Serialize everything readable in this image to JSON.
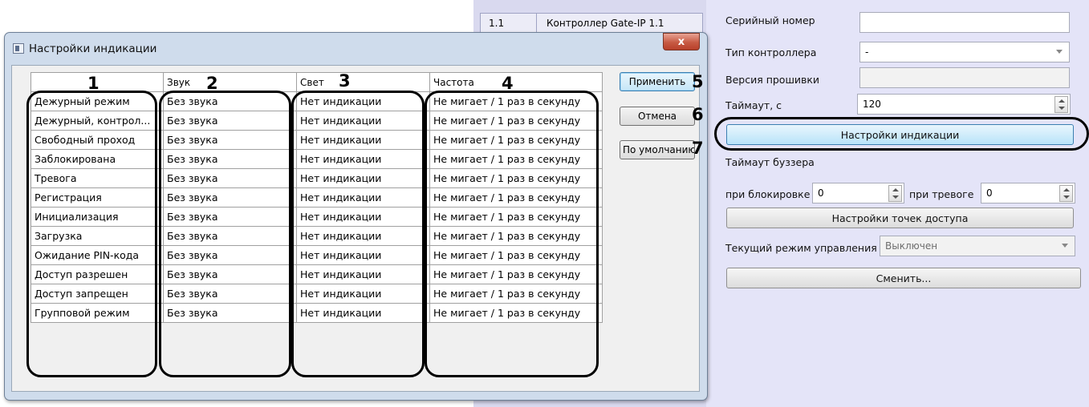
{
  "background": {
    "list_row": {
      "id": "1.1",
      "name": "Контроллер Gate-IP 1.1"
    },
    "serial_label": "Серийный номер",
    "serial_value": "",
    "type_label": "Тип контроллера",
    "type_value": "-",
    "firmware_label": "Версия прошивки",
    "firmware_value": "",
    "timeout_label": "Таймаут, с",
    "timeout_value": "120",
    "indication_button": "Настройки индикации",
    "buzzer_label": "Таймаут буззера",
    "block_label": "при блокировке",
    "block_value": "0",
    "alarm_label": "при тревоге",
    "alarm_value": "0",
    "access_points_button": "Настройки точек доступа",
    "mode_label": "Текущий режим управления",
    "mode_value": "Выключен",
    "change_button": "Сменить..."
  },
  "dialog": {
    "title": "Настройки индикации",
    "close_label": "x",
    "headers": [
      "",
      "Звук",
      "Свет",
      "Частота"
    ],
    "rows": [
      [
        "Дежурный режим",
        "Без звука",
        "Нет индикации",
        "Не мигает / 1 раз в секунду"
      ],
      [
        "Дежурный, контрол...",
        "Без звука",
        "Нет индикации",
        "Не мигает / 1 раз в секунду"
      ],
      [
        "Свободный проход",
        "Без звука",
        "Нет индикации",
        "Не мигает / 1 раз в секунду"
      ],
      [
        "Заблокирована",
        "Без звука",
        "Нет индикации",
        "Не мигает / 1 раз в секунду"
      ],
      [
        "Тревога",
        "Без звука",
        "Нет индикации",
        "Не мигает / 1 раз в секунду"
      ],
      [
        "Регистрация",
        "Без звука",
        "Нет индикации",
        "Не мигает / 1 раз в секунду"
      ],
      [
        "Инициализация",
        "Без звука",
        "Нет индикации",
        "Не мигает / 1 раз в секунду"
      ],
      [
        "Загрузка",
        "Без звука",
        "Нет индикации",
        "Не мигает / 1 раз в секунду"
      ],
      [
        "Ожидание PIN-кода",
        "Без звука",
        "Нет индикации",
        "Не мигает / 1 раз в секунду"
      ],
      [
        "Доступ разрешен",
        "Без звука",
        "Нет индикации",
        "Не мигает / 1 раз в секунду"
      ],
      [
        "Доступ запрещен",
        "Без звука",
        "Нет индикации",
        "Не мигает / 1 раз в секунду"
      ],
      [
        "Групповой режим",
        "Без звука",
        "Нет индикации",
        "Не мигает / 1 раз в секунду"
      ]
    ],
    "apply_button": "Применить",
    "cancel_button": "Отмена",
    "default_button": "По умолчанию"
  },
  "callouts": [
    "1",
    "2",
    "3",
    "4",
    "5",
    "6",
    "7"
  ]
}
